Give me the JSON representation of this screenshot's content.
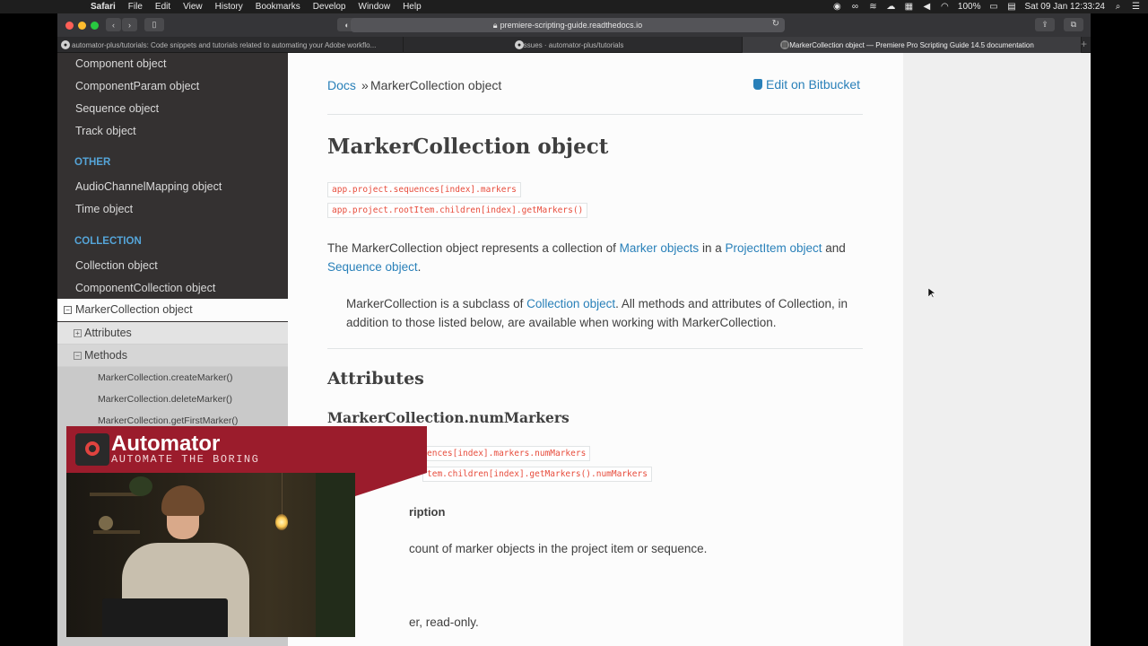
{
  "menubar": {
    "app": "Safari",
    "menus": [
      "File",
      "Edit",
      "View",
      "History",
      "Bookmarks",
      "Develop",
      "Window",
      "Help"
    ],
    "battery": "100%",
    "clock": "Sat 09 Jan  12:33:24"
  },
  "browser": {
    "url": "premiere-scripting-guide.readthedocs.io",
    "tabs": [
      {
        "title": "automator-plus/tutorials: Code snippets and tutorials related to automating your Adobe workflo..."
      },
      {
        "title": "Issues · automator-plus/tutorials"
      },
      {
        "title": "MarkerCollection object — Premiere Pro Scripting Guide 14.5 documentation"
      }
    ]
  },
  "sidebar": {
    "links_top": [
      "Component object",
      "ComponentParam object",
      "Sequence object",
      "Track object"
    ],
    "caption_other": "OTHER",
    "links_other": [
      "AudioChannelMapping object",
      "Time object"
    ],
    "caption_collection": "COLLECTION",
    "links_collection": [
      "Collection object",
      "ComponentCollection object"
    ],
    "current": "MarkerCollection object",
    "sub_attributes": "Attributes",
    "sub_methods": "Methods",
    "methods": [
      "MarkerCollection.createMarker()",
      "MarkerCollection.deleteMarker()",
      "MarkerCollection.getFirstMarker()"
    ]
  },
  "doc": {
    "breadcrumb_home": "Docs",
    "breadcrumb_sep": "»",
    "breadcrumb_current": "MarkerCollection object",
    "edit_link": "Edit on Bitbucket",
    "title": "MarkerCollection object",
    "code_paths": [
      "app.project.sequences[index].markers",
      "app.project.rootItem.children[index].getMarkers()"
    ],
    "intro": {
      "t1": "The MarkerCollection object represents a collection of ",
      "l1": "Marker objects",
      "t2": " in a ",
      "l2": "ProjectItem object",
      "t3": " and ",
      "l3": "Sequence object",
      "t4": "."
    },
    "note": {
      "t1": "MarkerCollection is a subclass of ",
      "l1": "Collection object",
      "t2": ". All methods and attributes of Collection, in addition to those listed below, are available when working with MarkerCollection."
    },
    "attributes_heading": "Attributes",
    "attr_name": "MarkerCollection.numMarkers",
    "attr_code_1": "ences[index].markers.numMarkers",
    "attr_code_2": "tem.children[index].getMarkers().numMarkers",
    "description_label": "ription",
    "description_text": "count of marker objects in the project item or sequence.",
    "type_text": "er, read-only."
  },
  "overlay": {
    "brand": "Automator",
    "tagline": "AUTOMATE THE BORING"
  }
}
